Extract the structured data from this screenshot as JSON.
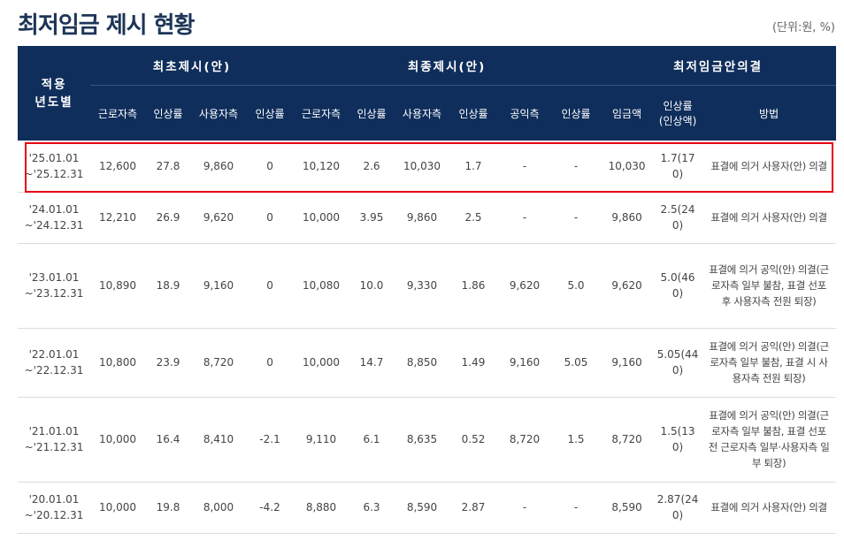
{
  "page": {
    "title": "최저임금 제시 현황",
    "unit": "(단위:원, %)"
  },
  "table": {
    "year_header": "적용\n년도별",
    "groups": {
      "first": "최초제시(안)",
      "final": "최종제시(안)",
      "decision": "최저임금안의결"
    },
    "subheaders": {
      "first_labor": "근로자측",
      "first_labor_rate": "인상률",
      "first_employer": "사용자측",
      "first_employer_rate": "인상률",
      "final_labor": "근로자측",
      "final_labor_rate": "인상률",
      "final_employer": "사용자측",
      "final_employer_rate": "인상률",
      "final_public": "공익측",
      "final_public_rate": "인상률",
      "decision_amount": "임금액",
      "decision_rate": "인상률\n(인상액)",
      "decision_method": "방법"
    },
    "rows": [
      {
        "year": "'25.01.01\n~'25.12.31",
        "first_labor": "12,600",
        "first_labor_rate": "27.8",
        "first_employer": "9,860",
        "first_employer_rate": "0",
        "final_labor": "10,120",
        "final_labor_rate": "2.6",
        "final_employer": "10,030",
        "final_employer_rate": "1.7",
        "final_public": "-",
        "final_public_rate": "-",
        "amount": "10,030",
        "rate": "1.7(170)",
        "method": "표결에 의거 사용자(안) 의결"
      },
      {
        "year": "'24.01.01\n~'24.12.31",
        "first_labor": "12,210",
        "first_labor_rate": "26.9",
        "first_employer": "9,620",
        "first_employer_rate": "0",
        "final_labor": "10,000",
        "final_labor_rate": "3.95",
        "final_employer": "9,860",
        "final_employer_rate": "2.5",
        "final_public": "-",
        "final_public_rate": "-",
        "amount": "9,860",
        "rate": "2.5(240)",
        "method": "표결에 의거 사용자(안) 의결"
      },
      {
        "year": "'23.01.01\n~'23.12.31",
        "first_labor": "10,890",
        "first_labor_rate": "18.9",
        "first_employer": "9,160",
        "first_employer_rate": "0",
        "final_labor": "10,080",
        "final_labor_rate": "10.0",
        "final_employer": "9,330",
        "final_employer_rate": "1.86",
        "final_public": "9,620",
        "final_public_rate": "5.0",
        "amount": "9,620",
        "rate": "5.0(460)",
        "method": "표결에 의거 공익(안) 의결(근로자측 일부 불참, 표결 선포 후 사용자측 전원 퇴장)"
      },
      {
        "year": "'22.01.01\n~'22.12.31",
        "first_labor": "10,800",
        "first_labor_rate": "23.9",
        "first_employer": "8,720",
        "first_employer_rate": "0",
        "final_labor": "10,000",
        "final_labor_rate": "14.7",
        "final_employer": "8,850",
        "final_employer_rate": "1.49",
        "final_public": "9,160",
        "final_public_rate": "5.05",
        "amount": "9,160",
        "rate": "5.05(440)",
        "method": "표결에 의거 공익(안) 의결(근로자측 일부 불참, 표결 시 사용자측 전원 퇴장)"
      },
      {
        "year": "'21.01.01\n~'21.12.31",
        "first_labor": "10,000",
        "first_labor_rate": "16.4",
        "first_employer": "8,410",
        "first_employer_rate": "-2.1",
        "final_labor": "9,110",
        "final_labor_rate": "6.1",
        "final_employer": "8,635",
        "final_employer_rate": "0.52",
        "final_public": "8,720",
        "final_public_rate": "1.5",
        "amount": "8,720",
        "rate": "1.5(130)",
        "method": "표결에 의거 공익(안) 의결(근로자측 일부 불참, 표결 선포 전 근로자측 일부·사용자측 일부 퇴장)"
      },
      {
        "year": "'20.01.01\n~'20.12.31",
        "first_labor": "10,000",
        "first_labor_rate": "19.8",
        "first_employer": "8,000",
        "first_employer_rate": "-4.2",
        "final_labor": "8,880",
        "final_labor_rate": "6.3",
        "final_employer": "8,590",
        "final_employer_rate": "2.87",
        "final_public": "-",
        "final_public_rate": "-",
        "amount": "8,590",
        "rate": "2.87(240)",
        "method": "표결에 의거 사용자(안) 의결"
      }
    ]
  },
  "colors": {
    "title": "#1d3557",
    "header_bg": "#0f2e5b",
    "highlight_border": "#e60012"
  }
}
